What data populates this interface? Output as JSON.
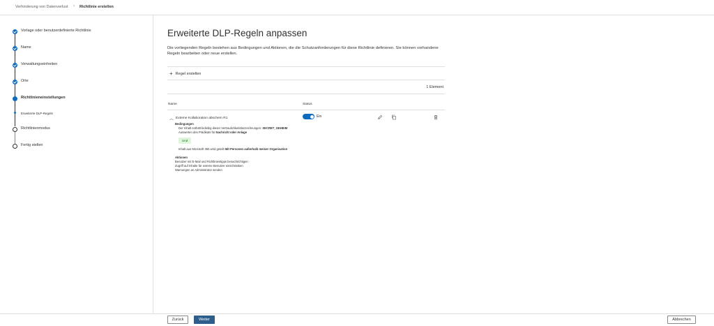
{
  "breadcrumb": {
    "parent": "Verhinderung von Datenverlust",
    "separator": "›",
    "current": "Richtlinie erstellen"
  },
  "steps": [
    {
      "label": "Vorlage oder benutzerdefinierte Richtlinie",
      "state": "done"
    },
    {
      "label": "Name",
      "state": "done"
    },
    {
      "label": "Verwaltungseinheiten",
      "state": "done"
    },
    {
      "label": "Orte",
      "state": "done"
    },
    {
      "label": "Richtlinieneinstellungen",
      "state": "current"
    },
    {
      "label": "Erweiterte DLP-Regeln",
      "state": "sub"
    },
    {
      "label": "Richtlinienmodus",
      "state": "open"
    },
    {
      "label": "Fertig stellen",
      "state": "open"
    }
  ],
  "main": {
    "title": "Erweiterte DLP-Regeln anpassen",
    "intro": "Die vorliegenden Regeln bestehen aus Bedingungen und Aktionen, die die Schutzanforderungen für diese Richtlinie definieren. Sie können vorhandene Regeln bearbeiten oder neue erstellen.",
    "create_rule": "Regel erstellen",
    "count": "1 Element",
    "columns": {
      "name": "Name",
      "status": "Status"
    }
  },
  "rule": {
    "name": "Externe Kollaboration abschern R1",
    "status": "Ein",
    "conditions_title": "Bedingungen",
    "cond1_prefix": "Der Inhalt enthält beliebig dieser Vertraulichkeitsbezeichnungen:",
    "cond1_value": "SECRET_GEHEIM",
    "cond2_prefix": "Auswerten des Prädikats für",
    "cond2_value": "Nachricht oder Anlage",
    "and_label": "Und",
    "cond3_prefix": "Inhalt aus Microsoft 365 wird geteilt",
    "cond3_value": "Mit Personen außerhalb meiner Organisation",
    "actions_title": "Aktionen",
    "actions": [
      "Benutzer mit E-Mail und Richtlinientipps benachrichtigen",
      "Zugriff auf Inhalte für externe Benutzer einschränken",
      "Warnungen an Administrator senden"
    ]
  },
  "footer": {
    "back": "Zurück",
    "next": "Weiter",
    "cancel": "Abbrechen"
  },
  "colors": {
    "accent": "#0f6cbd",
    "primary_button": "#2f5d8c",
    "and_badge_bg": "#dff6dd"
  },
  "icons": [
    "chevron-right-icon",
    "check-icon",
    "plus-icon",
    "chevron-up-icon",
    "edit-icon",
    "copy-icon",
    "delete-icon"
  ]
}
